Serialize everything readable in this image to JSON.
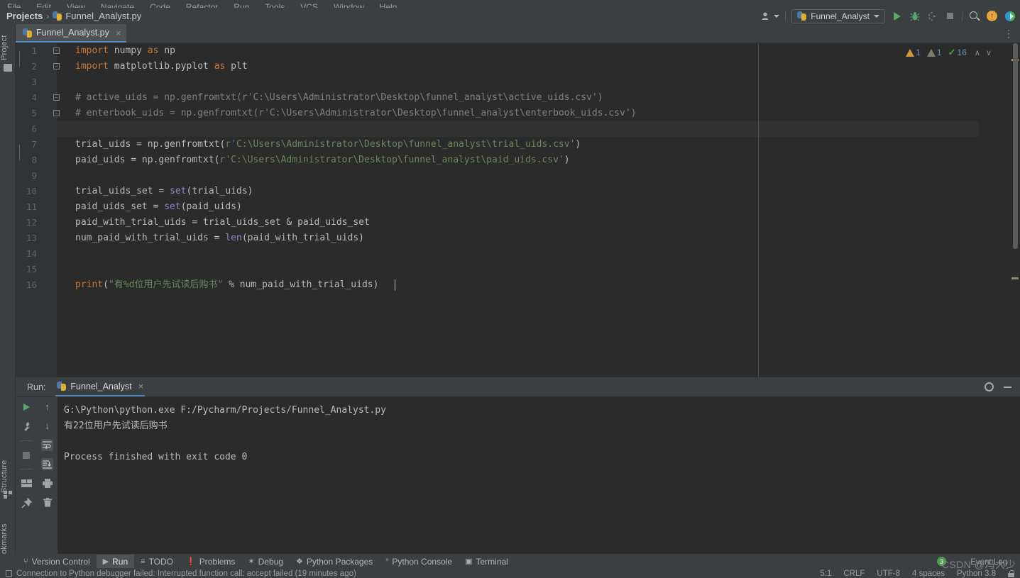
{
  "menubar": {
    "items": [
      "File",
      "Edit",
      "View",
      "Navigate",
      "Code",
      "Refactor",
      "Run",
      "Tools",
      "VCS",
      "Window",
      "Help"
    ]
  },
  "navbar": {
    "breadcrumb_root": "Projects",
    "breadcrumb_sep": "›",
    "breadcrumb_file": "Funnel_Analyst.py",
    "run_config": "Funnel_Analyst",
    "icons": {
      "user": "user-icon",
      "run": "run-icon",
      "debug": "debug-icon",
      "run_coverage": "run-with-coverage-icon",
      "stop": "stop-icon",
      "search": "search-icon",
      "update": "update-project-icon",
      "ide_assist": "ide-assistant-icon"
    }
  },
  "left_strip": {
    "tabs": [
      "Project",
      "Structure",
      "Bookmarks"
    ]
  },
  "editor": {
    "tab_title": "Funnel_Analyst.py",
    "tab_close": "×",
    "inspection": {
      "warnings": "1",
      "weak_warnings": "1",
      "checked": "16",
      "up": "∧",
      "down": "∨"
    },
    "lines": [
      {
        "n": "1",
        "fold": "−",
        "text": "import numpy as np"
      },
      {
        "n": "2",
        "fold": "−",
        "text": "import matplotlib.pyplot as plt"
      },
      {
        "n": "3",
        "fold": "",
        "text": ""
      },
      {
        "n": "4",
        "fold": "−",
        "text": "# active_uids = np.genfromtxt(r'C:\\Users\\Administrator\\Desktop\\funnel_analyst\\active_uids.csv')"
      },
      {
        "n": "5",
        "fold": "−",
        "text": "# enterbook_uids = np.genfromtxt(r'C:\\Users\\Administrator\\Desktop\\funnel_analyst\\enterbook_uids.csv')"
      },
      {
        "n": "6",
        "fold": "",
        "text": ""
      },
      {
        "n": "7",
        "fold": "",
        "text": "trial_uids = np.genfromtxt(r'C:\\Users\\Administrator\\Desktop\\funnel_analyst\\trial_uids.csv')"
      },
      {
        "n": "8",
        "fold": "",
        "text": "paid_uids = np.genfromtxt(r'C:\\Users\\Administrator\\Desktop\\funnel_analyst\\paid_uids.csv')"
      },
      {
        "n": "9",
        "fold": "",
        "text": ""
      },
      {
        "n": "10",
        "fold": "",
        "text": "trial_uids_set = set(trial_uids)"
      },
      {
        "n": "11",
        "fold": "",
        "text": "paid_uids_set = set(paid_uids)"
      },
      {
        "n": "12",
        "fold": "",
        "text": "paid_with_trial_uids = trial_uids_set & paid_uids_set"
      },
      {
        "n": "13",
        "fold": "",
        "text": "num_paid_with_trial_uids = len(paid_with_trial_uids)"
      },
      {
        "n": "14",
        "fold": "",
        "text": ""
      },
      {
        "n": "15",
        "fold": "",
        "text": ""
      },
      {
        "n": "16",
        "fold": "",
        "text": "print(\"有%d位用户先试读后购书\" % num_paid_with_trial_uids)"
      }
    ]
  },
  "run_window": {
    "label": "Run:",
    "tab_title": "Funnel_Analyst",
    "tab_close": "×",
    "settings_icon": "gear-icon",
    "hide_icon": "minimize-icon",
    "console_output": "G:\\Python\\python.exe F:/Pycharm/Projects/Funnel_Analyst.py\n有22位用户先试读后购书\n\nProcess finished with exit code 0",
    "left_tools": [
      "rerun-icon",
      "settings-icon",
      "stop-icon",
      "layout-icon",
      "pin-icon"
    ],
    "right_tools": [
      "up-arrow-icon",
      "down-arrow-icon",
      "soft-wrap-icon",
      "scroll-to-end-icon",
      "print-icon",
      "clear-all-icon"
    ]
  },
  "bottom_bar": {
    "windows": [
      {
        "label": "Version Control",
        "icon": "branch-icon",
        "active": false
      },
      {
        "label": "Run",
        "icon": "run-icon",
        "active": true
      },
      {
        "label": "TODO",
        "icon": "list-icon",
        "active": false
      },
      {
        "label": "Problems",
        "icon": "error-icon",
        "active": false
      },
      {
        "label": "Debug",
        "icon": "bug-icon",
        "active": false
      },
      {
        "label": "Python Packages",
        "icon": "packages-icon",
        "active": false
      },
      {
        "label": "Python Console",
        "icon": "python-icon",
        "active": false
      },
      {
        "label": "Terminal",
        "icon": "terminal-icon",
        "active": false
      }
    ]
  },
  "status_bar": {
    "message": "Connection to Python debugger failed: Interrupted function call: accept failed (19 minutes ago)",
    "caret_position": "5:1",
    "line_separator": "CRLF",
    "encoding": "UTF-8",
    "indent": "4 spaces",
    "interpreter": "Python 3.8",
    "lock_icon": "lock-icon",
    "event_log": "Event Log",
    "event_count": "3"
  },
  "watermark": {
    "text": "CSDN @冯大少"
  },
  "colors": {
    "background": "#3c3f41",
    "editor_background": "#2b2b2b",
    "gutter": "#313335",
    "accent": "#4a88c7",
    "run_green": "#59a869",
    "warning_orange": "#cc9a36",
    "keyword": "#cc7832",
    "string": "#6a8759",
    "comment": "#808080",
    "builtin": "#8888c6",
    "identifier": "#a9b7c6",
    "number": "#6897bb"
  }
}
